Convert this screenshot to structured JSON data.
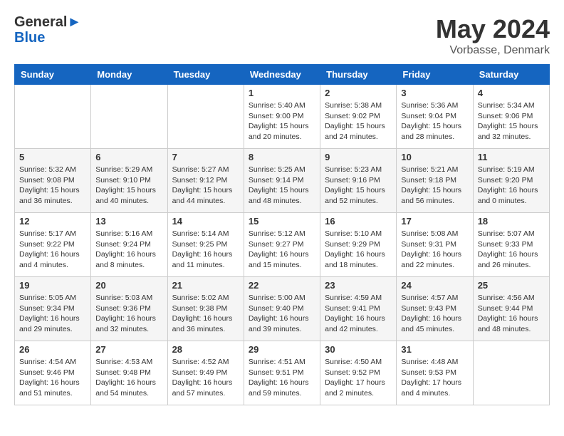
{
  "logo": {
    "general": "General",
    "blue": "Blue"
  },
  "title": {
    "month_year": "May 2024",
    "location": "Vorbasse, Denmark"
  },
  "days_of_week": [
    "Sunday",
    "Monday",
    "Tuesday",
    "Wednesday",
    "Thursday",
    "Friday",
    "Saturday"
  ],
  "weeks": [
    [
      {
        "day": "",
        "info": ""
      },
      {
        "day": "",
        "info": ""
      },
      {
        "day": "",
        "info": ""
      },
      {
        "day": "1",
        "info": "Sunrise: 5:40 AM\nSunset: 9:00 PM\nDaylight: 15 hours\nand 20 minutes."
      },
      {
        "day": "2",
        "info": "Sunrise: 5:38 AM\nSunset: 9:02 PM\nDaylight: 15 hours\nand 24 minutes."
      },
      {
        "day": "3",
        "info": "Sunrise: 5:36 AM\nSunset: 9:04 PM\nDaylight: 15 hours\nand 28 minutes."
      },
      {
        "day": "4",
        "info": "Sunrise: 5:34 AM\nSunset: 9:06 PM\nDaylight: 15 hours\nand 32 minutes."
      }
    ],
    [
      {
        "day": "5",
        "info": "Sunrise: 5:32 AM\nSunset: 9:08 PM\nDaylight: 15 hours\nand 36 minutes."
      },
      {
        "day": "6",
        "info": "Sunrise: 5:29 AM\nSunset: 9:10 PM\nDaylight: 15 hours\nand 40 minutes."
      },
      {
        "day": "7",
        "info": "Sunrise: 5:27 AM\nSunset: 9:12 PM\nDaylight: 15 hours\nand 44 minutes."
      },
      {
        "day": "8",
        "info": "Sunrise: 5:25 AM\nSunset: 9:14 PM\nDaylight: 15 hours\nand 48 minutes."
      },
      {
        "day": "9",
        "info": "Sunrise: 5:23 AM\nSunset: 9:16 PM\nDaylight: 15 hours\nand 52 minutes."
      },
      {
        "day": "10",
        "info": "Sunrise: 5:21 AM\nSunset: 9:18 PM\nDaylight: 15 hours\nand 56 minutes."
      },
      {
        "day": "11",
        "info": "Sunrise: 5:19 AM\nSunset: 9:20 PM\nDaylight: 16 hours\nand 0 minutes."
      }
    ],
    [
      {
        "day": "12",
        "info": "Sunrise: 5:17 AM\nSunset: 9:22 PM\nDaylight: 16 hours\nand 4 minutes."
      },
      {
        "day": "13",
        "info": "Sunrise: 5:16 AM\nSunset: 9:24 PM\nDaylight: 16 hours\nand 8 minutes."
      },
      {
        "day": "14",
        "info": "Sunrise: 5:14 AM\nSunset: 9:25 PM\nDaylight: 16 hours\nand 11 minutes."
      },
      {
        "day": "15",
        "info": "Sunrise: 5:12 AM\nSunset: 9:27 PM\nDaylight: 16 hours\nand 15 minutes."
      },
      {
        "day": "16",
        "info": "Sunrise: 5:10 AM\nSunset: 9:29 PM\nDaylight: 16 hours\nand 18 minutes."
      },
      {
        "day": "17",
        "info": "Sunrise: 5:08 AM\nSunset: 9:31 PM\nDaylight: 16 hours\nand 22 minutes."
      },
      {
        "day": "18",
        "info": "Sunrise: 5:07 AM\nSunset: 9:33 PM\nDaylight: 16 hours\nand 26 minutes."
      }
    ],
    [
      {
        "day": "19",
        "info": "Sunrise: 5:05 AM\nSunset: 9:34 PM\nDaylight: 16 hours\nand 29 minutes."
      },
      {
        "day": "20",
        "info": "Sunrise: 5:03 AM\nSunset: 9:36 PM\nDaylight: 16 hours\nand 32 minutes."
      },
      {
        "day": "21",
        "info": "Sunrise: 5:02 AM\nSunset: 9:38 PM\nDaylight: 16 hours\nand 36 minutes."
      },
      {
        "day": "22",
        "info": "Sunrise: 5:00 AM\nSunset: 9:40 PM\nDaylight: 16 hours\nand 39 minutes."
      },
      {
        "day": "23",
        "info": "Sunrise: 4:59 AM\nSunset: 9:41 PM\nDaylight: 16 hours\nand 42 minutes."
      },
      {
        "day": "24",
        "info": "Sunrise: 4:57 AM\nSunset: 9:43 PM\nDaylight: 16 hours\nand 45 minutes."
      },
      {
        "day": "25",
        "info": "Sunrise: 4:56 AM\nSunset: 9:44 PM\nDaylight: 16 hours\nand 48 minutes."
      }
    ],
    [
      {
        "day": "26",
        "info": "Sunrise: 4:54 AM\nSunset: 9:46 PM\nDaylight: 16 hours\nand 51 minutes."
      },
      {
        "day": "27",
        "info": "Sunrise: 4:53 AM\nSunset: 9:48 PM\nDaylight: 16 hours\nand 54 minutes."
      },
      {
        "day": "28",
        "info": "Sunrise: 4:52 AM\nSunset: 9:49 PM\nDaylight: 16 hours\nand 57 minutes."
      },
      {
        "day": "29",
        "info": "Sunrise: 4:51 AM\nSunset: 9:51 PM\nDaylight: 16 hours\nand 59 minutes."
      },
      {
        "day": "30",
        "info": "Sunrise: 4:50 AM\nSunset: 9:52 PM\nDaylight: 17 hours\nand 2 minutes."
      },
      {
        "day": "31",
        "info": "Sunrise: 4:48 AM\nSunset: 9:53 PM\nDaylight: 17 hours\nand 4 minutes."
      },
      {
        "day": "",
        "info": ""
      }
    ]
  ]
}
